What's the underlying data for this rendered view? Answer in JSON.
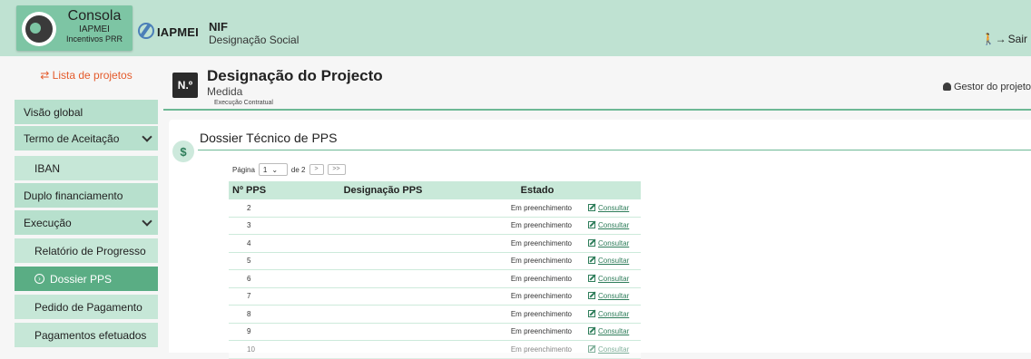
{
  "header": {
    "brand_title": "Consola",
    "brand_sub1": "IAPMEI",
    "brand_sub2": "Incentivos PRR",
    "org_name": "IAPMEI",
    "nif_label": "NIF",
    "designacao_social": "Designação Social",
    "logout_label": "Sair"
  },
  "sidebar": {
    "projects_link": "Lista de projetos",
    "items": [
      {
        "label": "Visão global"
      },
      {
        "label": "Termo de Aceitação"
      },
      {
        "label": "IBAN"
      },
      {
        "label": "Duplo financiamento"
      },
      {
        "label": "Execução"
      },
      {
        "label": "Relatório de Progresso"
      },
      {
        "label": "Dossier PPS"
      },
      {
        "label": "Pedido de Pagamento"
      },
      {
        "label": "Pagamentos efetuados"
      }
    ]
  },
  "project": {
    "badge": "N.º",
    "title": "Designação do Projecto",
    "medida": "Medida",
    "execucao": "Execução Contratual",
    "gestor": "Gestor do projeto"
  },
  "panel": {
    "title": "Dossier Técnico de PPS",
    "icon": "$"
  },
  "pager": {
    "page_label": "Página",
    "current": "1",
    "of_label": "de 2",
    "next": ">",
    "last": ">>"
  },
  "table": {
    "headers": [
      "Nº PPS",
      "Designação PPS",
      "Estado"
    ],
    "rows": [
      {
        "num": "2",
        "estado": "Em preenchimento",
        "action": "Consultar"
      },
      {
        "num": "3",
        "estado": "Em preenchimento",
        "action": "Consultar"
      },
      {
        "num": "4",
        "estado": "Em preenchimento",
        "action": "Consultar"
      },
      {
        "num": "5",
        "estado": "Em preenchimento",
        "action": "Consultar"
      },
      {
        "num": "6",
        "estado": "Em preenchimento",
        "action": "Consultar"
      },
      {
        "num": "7",
        "estado": "Em preenchimento",
        "action": "Consultar"
      },
      {
        "num": "8",
        "estado": "Em preenchimento",
        "action": "Consultar"
      },
      {
        "num": "9",
        "estado": "Em preenchimento",
        "action": "Consultar"
      },
      {
        "num": "10",
        "estado": "Em preenchimento",
        "action": "Consultar"
      }
    ]
  }
}
